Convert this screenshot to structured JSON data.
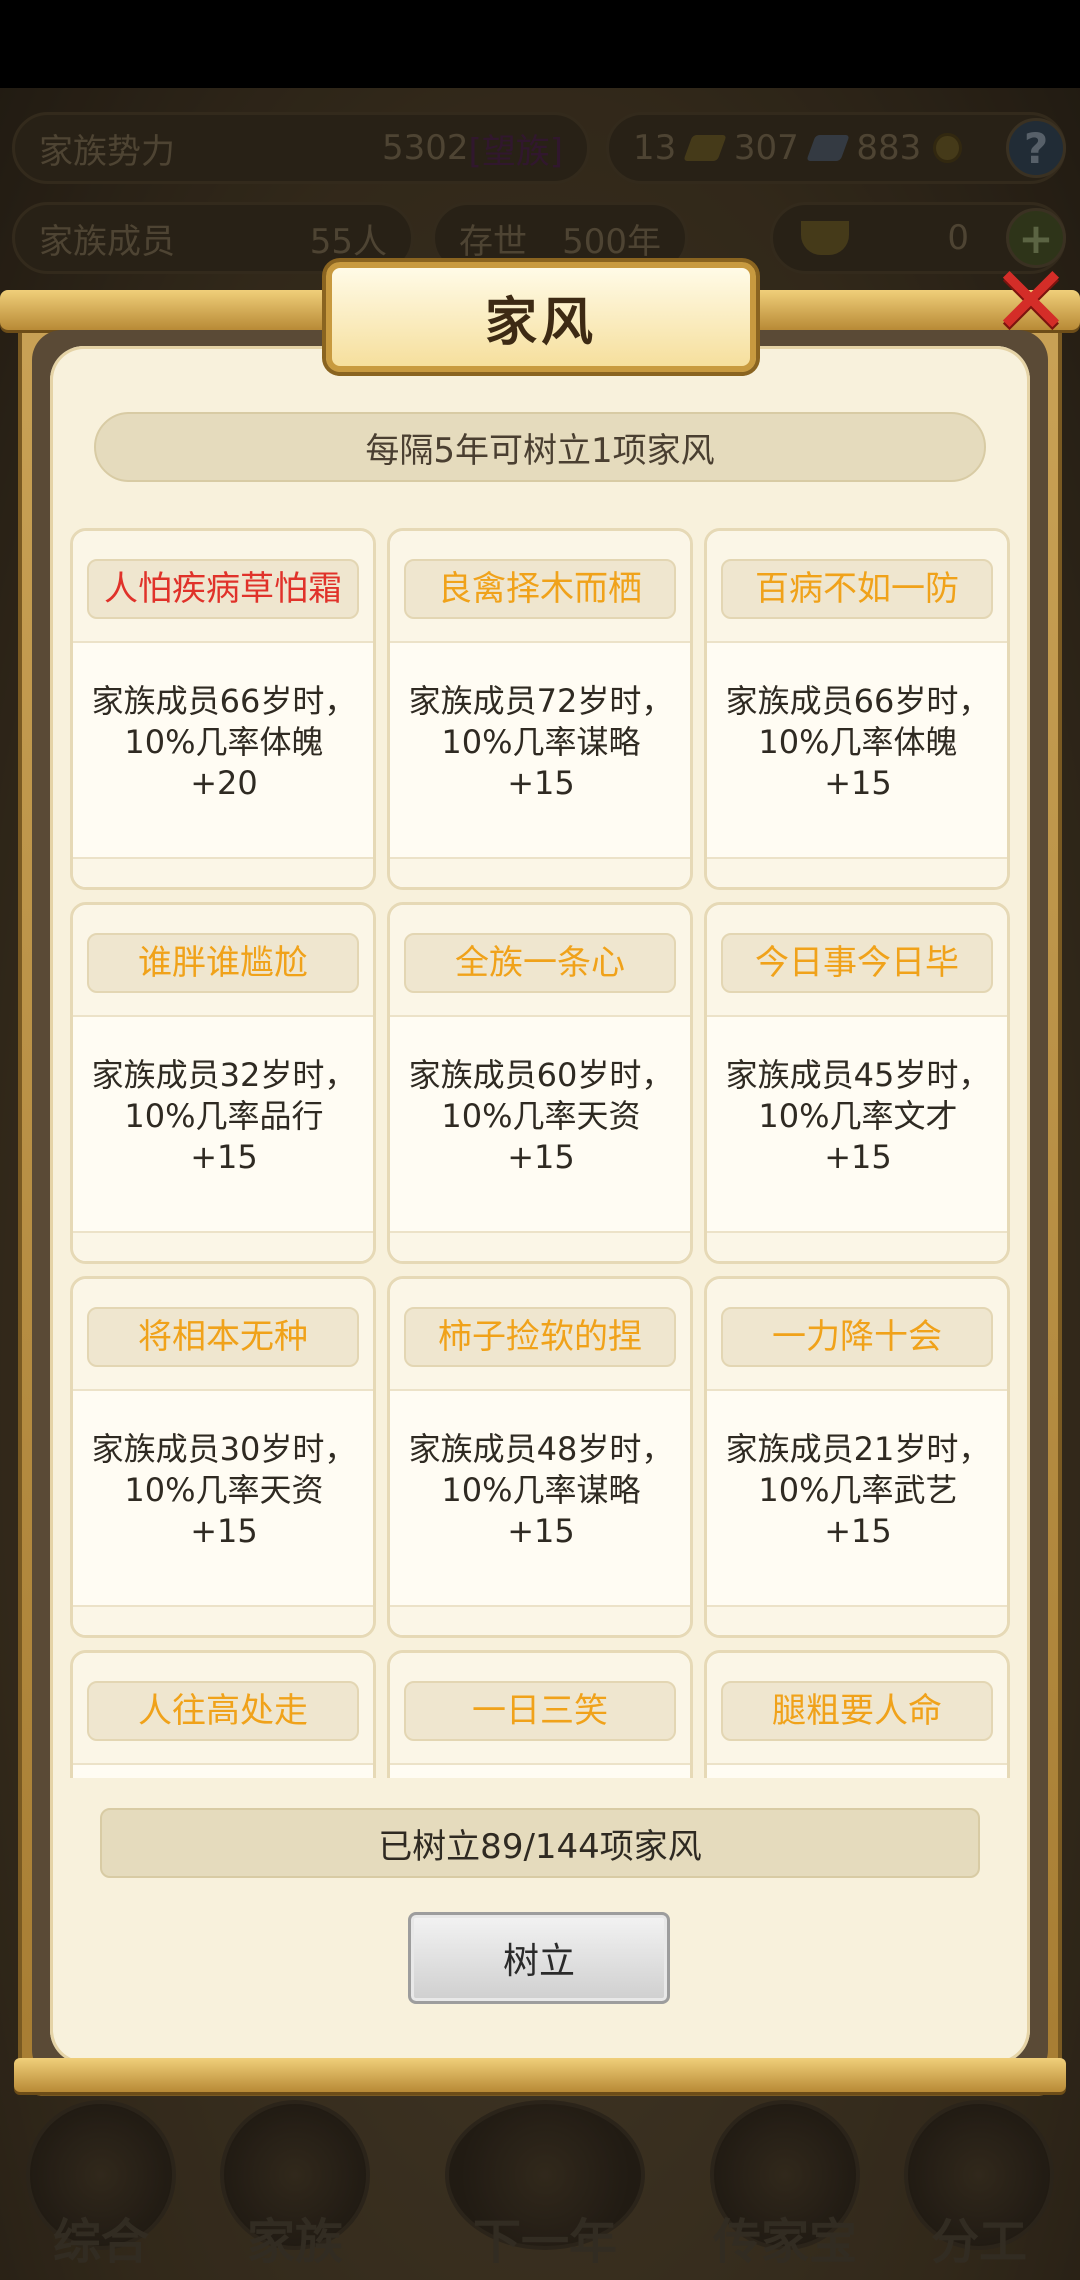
{
  "hud": {
    "power_label": "家族势力",
    "power_value": "5302",
    "power_tag": "[望族]",
    "gold_bars": "13",
    "silver_bars": "307",
    "coins": "883",
    "help_symbol": "?",
    "members_label": "家族成员",
    "members_value": "55人",
    "age_label": "存世",
    "age_value": "500年",
    "ingots": "0",
    "plus_symbol": "+"
  },
  "dialog": {
    "title": "家风",
    "close_symbol": "✕",
    "rule": "每隔5年可树立1项家风",
    "cards": [
      {
        "name": "人怕疾病草怕霜",
        "desc": "家族成员66岁时，10%几率体魄+20",
        "highlight": true
      },
      {
        "name": "良禽择木而栖",
        "desc": "家族成员72岁时，10%几率谋略+15",
        "highlight": false
      },
      {
        "name": "百病不如一防",
        "desc": "家族成员66岁时，10%几率体魄+15",
        "highlight": false
      },
      {
        "name": "谁胖谁尴尬",
        "desc": "家族成员32岁时，10%几率品行+15",
        "highlight": false
      },
      {
        "name": "全族一条心",
        "desc": "家族成员60岁时，10%几率天资+15",
        "highlight": false
      },
      {
        "name": "今日事今日毕",
        "desc": "家族成员45岁时，10%几率文才+15",
        "highlight": false
      },
      {
        "name": "将相本无种",
        "desc": "家族成员30岁时，10%几率天资+15",
        "highlight": false
      },
      {
        "name": "柿子捡软的捏",
        "desc": "家族成员48岁时，10%几率谋略+15",
        "highlight": false
      },
      {
        "name": "一力降十会",
        "desc": "家族成员21岁时，10%几率武艺+15",
        "highlight": false
      },
      {
        "name": "人往高处走",
        "desc": "",
        "highlight": false
      },
      {
        "name": "一日三笑",
        "desc": "",
        "highlight": false
      },
      {
        "name": "腿粗要人命",
        "desc": "",
        "highlight": false
      }
    ],
    "count_text": "已树立89/144项家风",
    "establish_label": "树立"
  },
  "nav": [
    {
      "label": "综合",
      "icon": "scroll-icon"
    },
    {
      "label": "家族",
      "icon": "house-icon"
    },
    {
      "label": "下一年",
      "icon": "mountain-icon"
    },
    {
      "label": "传家宝",
      "icon": "treasure-icon"
    },
    {
      "label": "分工",
      "icon": "people-icon"
    }
  ],
  "colors": {
    "highlight_name": "#e0322a",
    "normal_name": "#f0a21a",
    "panel_bg": "#f8f1dc",
    "frame_gold": "#c9a256"
  }
}
